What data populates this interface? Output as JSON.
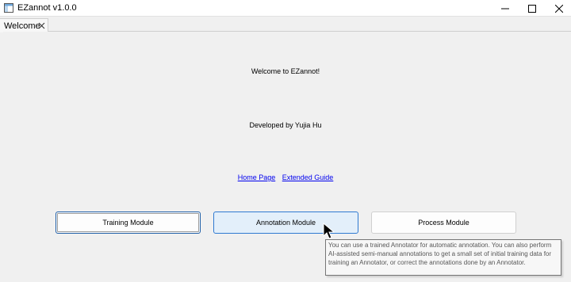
{
  "window": {
    "title": "EZannot v1.0.0"
  },
  "tabs": [
    {
      "label": "Welcome"
    }
  ],
  "welcome": {
    "greeting": "Welcome to EZannot!",
    "developer": "Developed by Yujia Hu",
    "links": {
      "home_page": "Home Page",
      "extended_guide": "Extended Guide"
    }
  },
  "modules": {
    "training": "Training Module",
    "annotation": "Annotation Module",
    "process": "Process Module"
  },
  "tooltip": {
    "text": "You can use a trained Annotator for automatic annotation. You can also perform AI-assisted semi-manual annotations to get a small set of initial training data for training an Annotator, or correct the annotations done by an Annotator."
  },
  "colors": {
    "link": "#0000ee",
    "focus_border": "#1f5fa8",
    "hover_fill": "#e3effa",
    "hover_border": "#2f7ad1"
  }
}
